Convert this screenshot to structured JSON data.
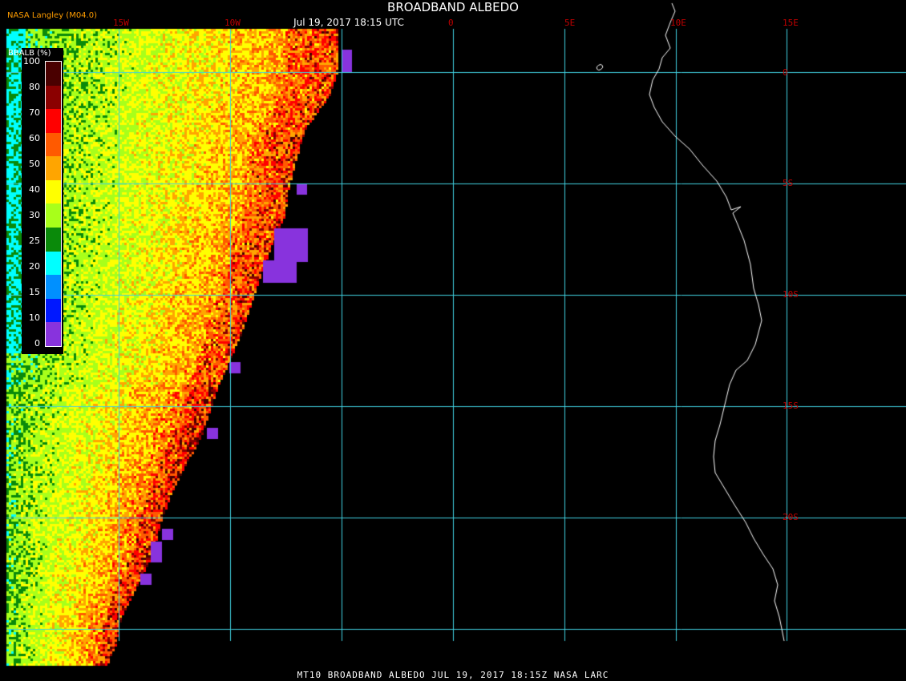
{
  "header": {
    "title": "BROADBAND ALBEDO",
    "timestamp": "Jul 19, 2017 18:15 UTC",
    "source": "NASA Langley (M04.0)"
  },
  "footer": {
    "caption": "MT10  BROADBAND ALBEDO   JUL 19, 2017 18:15Z   NASA LARC"
  },
  "grid": {
    "longitude_labels": [
      "15W",
      "10W",
      "0",
      "5E",
      "10E",
      "15E"
    ],
    "latitude_labels": [
      "0",
      "5S",
      "10S",
      "15S",
      "20S"
    ],
    "line_color": "#40d0e0",
    "label_color": "#c00000"
  },
  "legend": {
    "title": "BBALB (%)",
    "ticks": [
      "100",
      "80",
      "70",
      "60",
      "50",
      "40",
      "30",
      "25",
      "20",
      "15",
      "10",
      "0"
    ],
    "colors": [
      "#4a0000",
      "#8b0000",
      "#ff0000",
      "#ff5a00",
      "#ffa500",
      "#ffff00",
      "#a8ff1a",
      "#0a8a0a",
      "#00ffff",
      "#0090ff",
      "#0018ff",
      "#8833dd"
    ]
  },
  "coastline_color": "#ffffff",
  "background_color": "#000000"
}
